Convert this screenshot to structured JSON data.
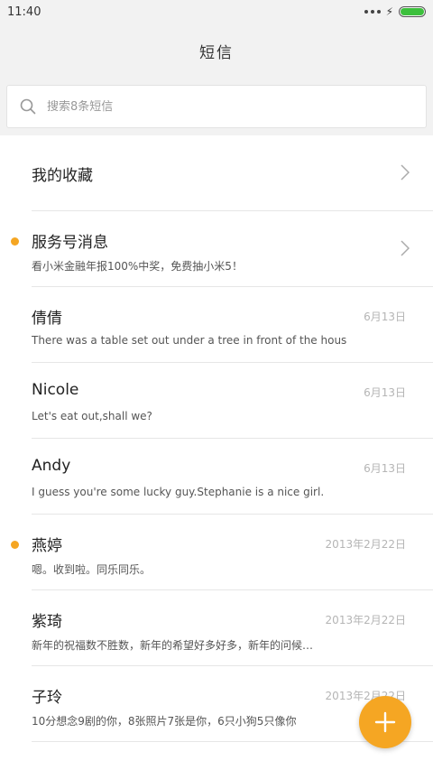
{
  "status": {
    "time": "11:40"
  },
  "header": {
    "title": "短信"
  },
  "search": {
    "placeholder": "搜索8条短信"
  },
  "favorites": {
    "label": "我的收藏"
  },
  "conversations": [
    {
      "name": "服务号消息",
      "preview": "看小米金融年报100%中奖，免费抽小米5！",
      "time": "",
      "unread": true,
      "chevron": true
    },
    {
      "name": "倩倩",
      "preview": "There was a table set out under a tree in front of the hous",
      "time": "6月13日",
      "unread": false
    },
    {
      "name": "Nicole",
      "preview": "Let's eat out,shall we?",
      "time": "6月13日",
      "unread": false
    },
    {
      "name": "Andy",
      "preview": "I guess you're some lucky guy.Stephanie is a nice girl.",
      "time": "6月13日",
      "unread": false
    },
    {
      "name": "燕婷",
      "preview": "嗯。收到啦。同乐同乐。",
      "time": "2013年2月22日",
      "unread": true
    },
    {
      "name": "紫琦",
      "preview": "新年的祝福数不胜数，新年的希望好多好多，新年的问候…",
      "time": "2013年2月22日",
      "unread": false
    },
    {
      "name": "子玲",
      "preview": "10分想念9剧的你，8张照片7张是你，6只小狗5只像你",
      "time": "2013年2月22日",
      "unread": false
    }
  ],
  "colors": {
    "accent": "#f5a623",
    "battery": "#3cc03c"
  },
  "icons": {
    "search": "search-icon",
    "chevron": "chevron-right-icon",
    "fab": "plus-icon"
  }
}
